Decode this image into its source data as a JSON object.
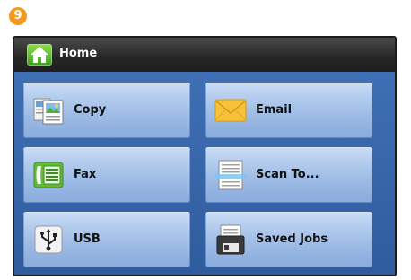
{
  "step": {
    "number": "9"
  },
  "header": {
    "title": "Home",
    "icon": "home-icon"
  },
  "tiles": [
    {
      "label": "Copy",
      "icon": "copy-icon"
    },
    {
      "label": "Email",
      "icon": "email-icon"
    },
    {
      "label": "Fax",
      "icon": "fax-icon"
    },
    {
      "label": "Scan To...",
      "icon": "scan-icon"
    },
    {
      "label": "USB",
      "icon": "usb-icon"
    },
    {
      "label": "Saved Jobs",
      "icon": "saved-jobs-icon"
    }
  ],
  "colors": {
    "badge": "#f39a1e",
    "titlebar": "#262626",
    "content_bg": "#3f6fb4",
    "tile": "#a6c2e9",
    "home_icon": "#5bbd2f"
  }
}
